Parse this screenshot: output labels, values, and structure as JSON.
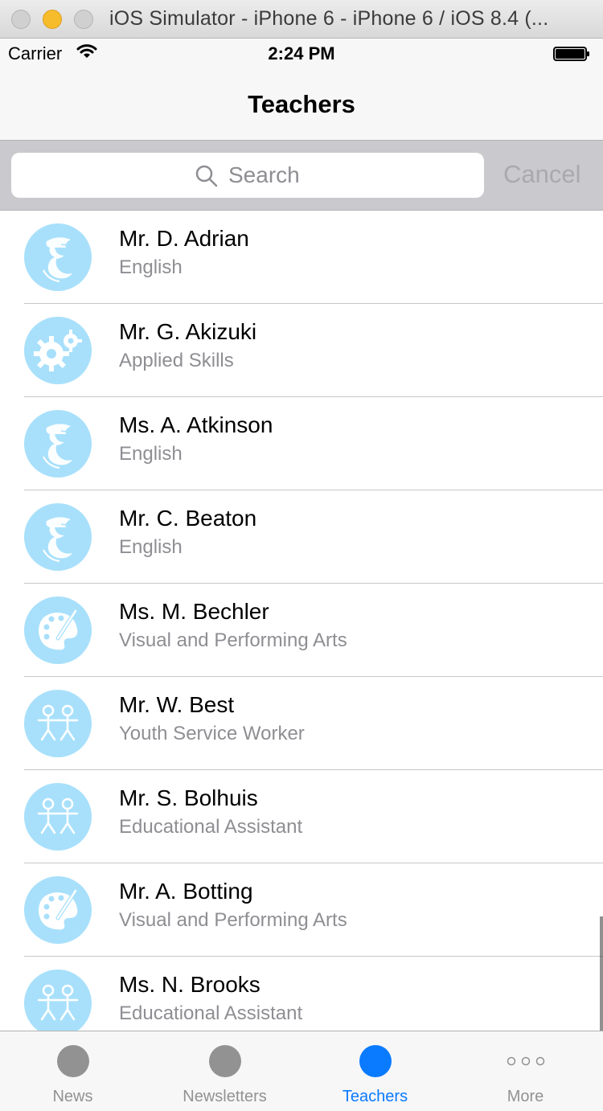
{
  "window": {
    "title": "iOS Simulator - iPhone 6 - iPhone 6 / iOS 8.4 (..."
  },
  "status_bar": {
    "carrier": "Carrier",
    "time": "2:24 PM"
  },
  "nav": {
    "title": "Teachers"
  },
  "search": {
    "placeholder": "Search",
    "cancel_label": "Cancel"
  },
  "teachers": [
    {
      "name": "Mr. D. Adrian",
      "department": "English",
      "icon": "english-letter-icon"
    },
    {
      "name": "Mr. G. Akizuki",
      "department": "Applied Skills",
      "icon": "gears-icon"
    },
    {
      "name": "Ms. A. Atkinson",
      "department": "English",
      "icon": "english-letter-icon"
    },
    {
      "name": "Mr. C. Beaton",
      "department": "English",
      "icon": "english-letter-icon"
    },
    {
      "name": "Ms. M. Bechler",
      "department": "Visual and Performing Arts",
      "icon": "palette-icon"
    },
    {
      "name": "Mr. W. Best",
      "department": "Youth Service Worker",
      "icon": "people-icon"
    },
    {
      "name": "Mr. S. Bolhuis",
      "department": "Educational Assistant",
      "icon": "people-icon"
    },
    {
      "name": "Mr. A. Botting",
      "department": "Visual and Performing Arts",
      "icon": "palette-icon"
    },
    {
      "name": "Ms. N. Brooks",
      "department": "Educational Assistant",
      "icon": "people-icon"
    }
  ],
  "tabs": [
    {
      "label": "News",
      "icon": "circle-icon",
      "active": false
    },
    {
      "label": "Newsletters",
      "icon": "circle-icon",
      "active": false
    },
    {
      "label": "Teachers",
      "icon": "circle-icon",
      "active": true
    },
    {
      "label": "More",
      "icon": "more-dots-icon",
      "active": false
    }
  ],
  "colors": {
    "accent": "#0a7aff",
    "avatar_bg": "#a8e0fb",
    "search_bar_bg": "#c9c9ce",
    "secondary_text": "#8e8e93"
  }
}
